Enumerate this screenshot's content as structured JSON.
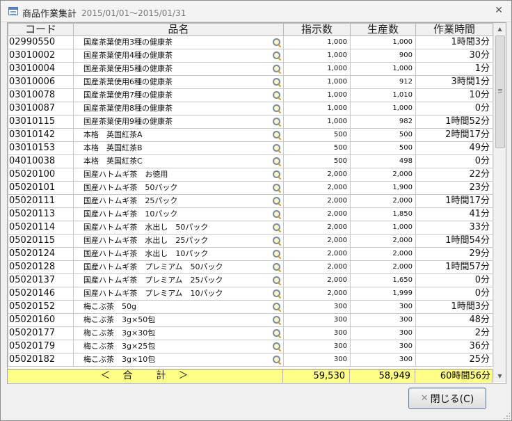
{
  "window": {
    "title": "商品作業集計",
    "date_range": "2015/01/01〜2015/01/31"
  },
  "table": {
    "columns": [
      "コード",
      "品名",
      "指示数",
      "生産数",
      "作業時間"
    ],
    "rows": [
      {
        "code": "02990550",
        "name": "国産茶葉使用3種の健康茶",
        "shiji": "1,000",
        "seisan": "1,000",
        "time": "1時間3分"
      },
      {
        "code": "03010002",
        "name": "国産茶葉使用4種の健康茶",
        "shiji": "1,000",
        "seisan": "900",
        "time": "30分"
      },
      {
        "code": "03010004",
        "name": "国産茶葉使用5種の健康茶",
        "shiji": "1,000",
        "seisan": "1,000",
        "time": "1分"
      },
      {
        "code": "03010006",
        "name": "国産茶葉使用6種の健康茶",
        "shiji": "1,000",
        "seisan": "912",
        "time": "3時間1分"
      },
      {
        "code": "03010078",
        "name": "国産茶葉使用7種の健康茶",
        "shiji": "1,000",
        "seisan": "1,010",
        "time": "10分"
      },
      {
        "code": "03010087",
        "name": "国産茶葉使用8種の健康茶",
        "shiji": "1,000",
        "seisan": "1,000",
        "time": "0分"
      },
      {
        "code": "03010115",
        "name": "国産茶葉使用9種の健康茶",
        "shiji": "1,000",
        "seisan": "982",
        "time": "1時間52分"
      },
      {
        "code": "03010142",
        "name": "本格　英国紅茶A",
        "shiji": "500",
        "seisan": "500",
        "time": "2時間17分"
      },
      {
        "code": "03010153",
        "name": "本格　英国紅茶B",
        "shiji": "500",
        "seisan": "500",
        "time": "49分"
      },
      {
        "code": "04010038",
        "name": "本格　英国紅茶C",
        "shiji": "500",
        "seisan": "498",
        "time": "0分"
      },
      {
        "code": "05020100",
        "name": "国産ハトムギ茶　お徳用",
        "shiji": "2,000",
        "seisan": "2,000",
        "time": "22分"
      },
      {
        "code": "05020101",
        "name": "国産ハトムギ茶　50パック",
        "shiji": "2,000",
        "seisan": "1,900",
        "time": "23分"
      },
      {
        "code": "05020111",
        "name": "国産ハトムギ茶　25パック",
        "shiji": "2,000",
        "seisan": "2,000",
        "time": "1時間17分"
      },
      {
        "code": "05020113",
        "name": "国産ハトムギ茶　10パック",
        "shiji": "2,000",
        "seisan": "1,850",
        "time": "41分"
      },
      {
        "code": "05020114",
        "name": "国産ハトムギ茶　水出し　50パック",
        "shiji": "2,000",
        "seisan": "1,000",
        "time": "33分"
      },
      {
        "code": "05020115",
        "name": "国産ハトムギ茶　水出し　25パック",
        "shiji": "2,000",
        "seisan": "2,000",
        "time": "1時間54分"
      },
      {
        "code": "05020124",
        "name": "国産ハトムギ茶　水出し　10パック",
        "shiji": "2,000",
        "seisan": "2,000",
        "time": "29分"
      },
      {
        "code": "05020128",
        "name": "国産ハトムギ茶　プレミアム　50パック",
        "shiji": "2,000",
        "seisan": "2,000",
        "time": "1時間57分"
      },
      {
        "code": "05020137",
        "name": "国産ハトムギ茶　プレミアム　25パック",
        "shiji": "2,000",
        "seisan": "1,650",
        "time": "0分"
      },
      {
        "code": "05020146",
        "name": "国産ハトムギ茶　プレミアム　10パック",
        "shiji": "2,000",
        "seisan": "1,999",
        "time": "0分"
      },
      {
        "code": "05020152",
        "name": "梅こぶ茶　50g",
        "shiji": "300",
        "seisan": "300",
        "time": "1時間3分"
      },
      {
        "code": "05020160",
        "name": "梅こぶ茶　3g×50包",
        "shiji": "300",
        "seisan": "300",
        "time": "48分"
      },
      {
        "code": "05020177",
        "name": "梅こぶ茶　3g×30包",
        "shiji": "300",
        "seisan": "300",
        "time": "2分"
      },
      {
        "code": "05020179",
        "name": "梅こぶ茶　3g×25包",
        "shiji": "300",
        "seisan": "300",
        "time": "36分"
      },
      {
        "code": "05020182",
        "name": "梅こぶ茶　3g×10包",
        "shiji": "300",
        "seisan": "300",
        "time": "25分"
      }
    ]
  },
  "totals": {
    "label": "＜　合　　計　＞",
    "shiji": "59,530",
    "seisan": "58,949",
    "time": "60時間56分"
  },
  "buttons": {
    "close_label": "閉じる(C)"
  }
}
